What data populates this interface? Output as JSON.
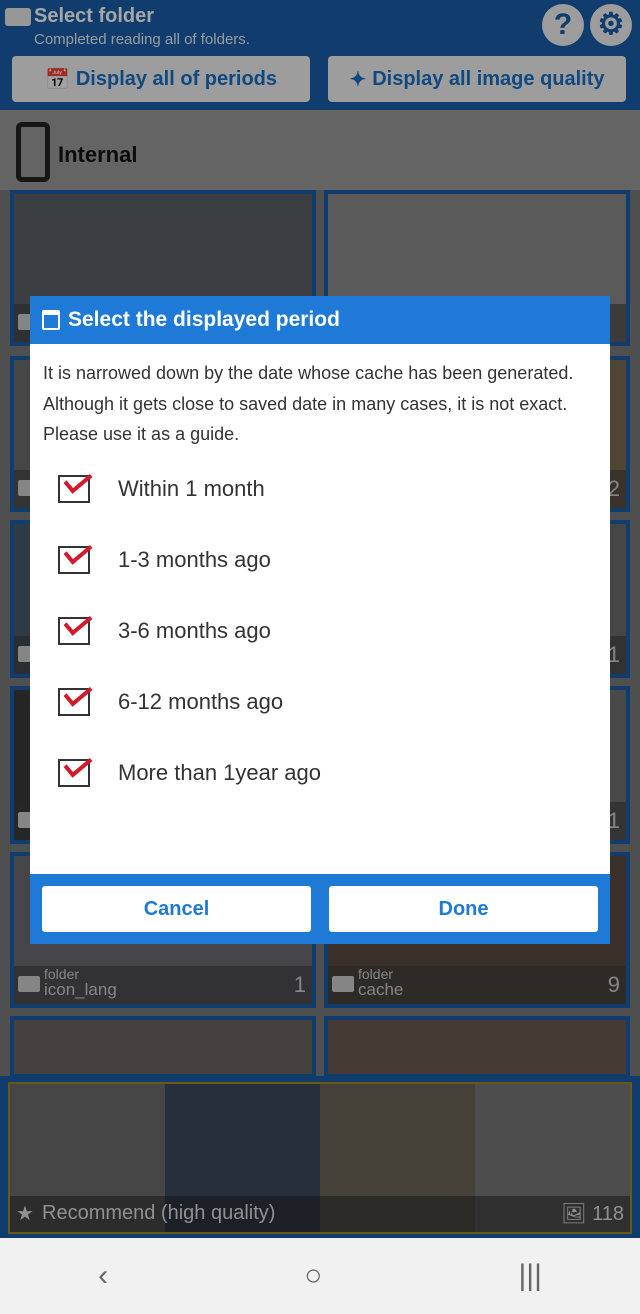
{
  "header": {
    "title": "Select folder",
    "subtitle": "Completed reading all of folders.",
    "help_icon": "question-icon",
    "settings_icon": "gear-icon",
    "periods_button": "Display all of periods",
    "quality_button": "Display all image quality"
  },
  "storage": {
    "label": "Internal"
  },
  "tiles": [
    {
      "folder": "",
      "name": "",
      "count": ""
    },
    {
      "folder": "",
      "name": "",
      "count": ""
    },
    {
      "folder": "",
      "name": "",
      "count": ""
    },
    {
      "folder": "",
      "name": "",
      "count": "2"
    },
    {
      "folder": "",
      "name": "",
      "count": ""
    },
    {
      "folder": "",
      "name": "",
      "count": "1"
    },
    {
      "folder": "",
      "name": "",
      "count": ""
    },
    {
      "folder": "",
      "name": "",
      "count": "1"
    },
    {
      "folder": "folder",
      "name": "icon_lang",
      "count": "1"
    },
    {
      "folder": "folder",
      "name": "cache",
      "count": "9"
    }
  ],
  "recommend": {
    "label": "Recommend (high quality)",
    "count": "118"
  },
  "dialog": {
    "title": "Select the displayed period",
    "description": [
      "It is narrowed down by the date whose cache has been generated.",
      "Although it gets close to saved date in many cases, it is not exact.",
      "Please use it as a guide."
    ],
    "options": [
      {
        "label": "Within 1 month",
        "checked": true
      },
      {
        "label": "1-3 months ago",
        "checked": true
      },
      {
        "label": "3-6 months ago",
        "checked": true
      },
      {
        "label": "6-12 months ago",
        "checked": true
      },
      {
        "label": "More than 1year ago",
        "checked": true
      }
    ],
    "cancel": "Cancel",
    "done": "Done"
  },
  "colors": {
    "primary": "#1a5fa8",
    "dialog_accent": "#1e7ad6",
    "check": "#d21a2a"
  }
}
